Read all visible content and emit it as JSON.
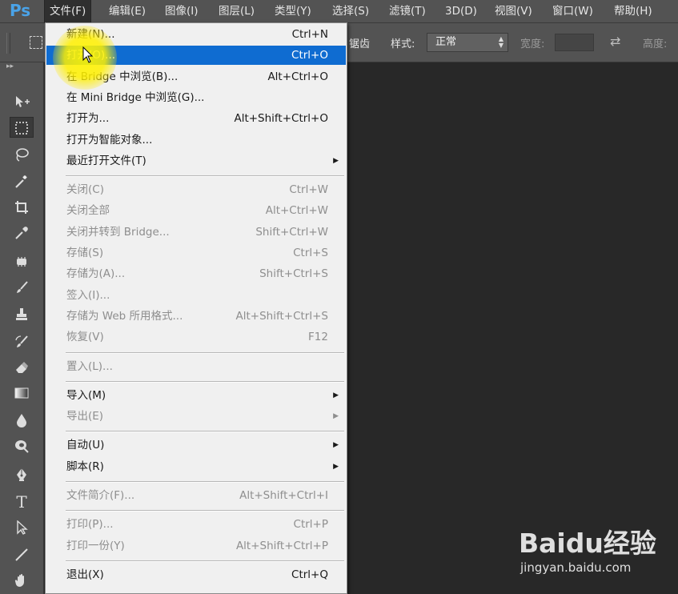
{
  "app": {
    "logo": "Ps"
  },
  "menubar": [
    {
      "label": "文件(F)",
      "active": true
    },
    {
      "label": "编辑(E)"
    },
    {
      "label": "图像(I)"
    },
    {
      "label": "图层(L)"
    },
    {
      "label": "类型(Y)"
    },
    {
      "label": "选择(S)"
    },
    {
      "label": "滤镜(T)"
    },
    {
      "label": "3D(D)"
    },
    {
      "label": "视图(V)"
    },
    {
      "label": "窗口(W)"
    },
    {
      "label": "帮助(H)"
    }
  ],
  "options": {
    "partial_label": "锯齿",
    "style_label": "样式:",
    "style_value": "正常",
    "width_label": "宽度:",
    "width_value": "",
    "height_label": "高度:"
  },
  "file_menu": [
    {
      "label": "新建(N)...",
      "shortcut": "Ctrl+N"
    },
    {
      "label": "打开(O)...",
      "shortcut": "Ctrl+O",
      "highlighted": true
    },
    {
      "label": "在 Bridge 中浏览(B)...",
      "shortcut": "Alt+Ctrl+O"
    },
    {
      "label": "在 Mini Bridge 中浏览(G)...",
      "shortcut": ""
    },
    {
      "label": "打开为...",
      "shortcut": "Alt+Shift+Ctrl+O"
    },
    {
      "label": "打开为智能对象...",
      "shortcut": ""
    },
    {
      "label": "最近打开文件(T)",
      "shortcut": "",
      "submenu": true
    },
    {
      "separator": true
    },
    {
      "label": "关闭(C)",
      "shortcut": "Ctrl+W",
      "disabled": true
    },
    {
      "label": "关闭全部",
      "shortcut": "Alt+Ctrl+W",
      "disabled": true
    },
    {
      "label": "关闭并转到 Bridge...",
      "shortcut": "Shift+Ctrl+W",
      "disabled": true
    },
    {
      "label": "存储(S)",
      "shortcut": "Ctrl+S",
      "disabled": true
    },
    {
      "label": "存储为(A)...",
      "shortcut": "Shift+Ctrl+S",
      "disabled": true
    },
    {
      "label": "签入(I)...",
      "shortcut": "",
      "disabled": true
    },
    {
      "label": "存储为 Web 所用格式...",
      "shortcut": "Alt+Shift+Ctrl+S",
      "disabled": true
    },
    {
      "label": "恢复(V)",
      "shortcut": "F12",
      "disabled": true
    },
    {
      "separator": true
    },
    {
      "label": "置入(L)...",
      "shortcut": "",
      "disabled": true
    },
    {
      "separator": true
    },
    {
      "label": "导入(M)",
      "shortcut": "",
      "submenu": true
    },
    {
      "label": "导出(E)",
      "shortcut": "",
      "submenu": true,
      "disabled": true
    },
    {
      "separator": true
    },
    {
      "label": "自动(U)",
      "shortcut": "",
      "submenu": true
    },
    {
      "label": "脚本(R)",
      "shortcut": "",
      "submenu": true
    },
    {
      "separator": true
    },
    {
      "label": "文件简介(F)...",
      "shortcut": "Alt+Shift+Ctrl+I",
      "disabled": true
    },
    {
      "separator": true
    },
    {
      "label": "打印(P)...",
      "shortcut": "Ctrl+P",
      "disabled": true
    },
    {
      "label": "打印一份(Y)",
      "shortcut": "Alt+Shift+Ctrl+P",
      "disabled": true
    },
    {
      "separator": true
    },
    {
      "label": "退出(X)",
      "shortcut": "Ctrl+Q"
    }
  ],
  "submenu_arrow": "▶",
  "tools": [
    {
      "name": "move-tool-icon"
    },
    {
      "name": "rectangular-marquee-tool-icon",
      "selected": true
    },
    {
      "name": "lasso-tool-icon"
    },
    {
      "name": "magic-wand-tool-icon"
    },
    {
      "name": "crop-tool-icon"
    },
    {
      "name": "eyedropper-tool-icon"
    },
    {
      "name": "spot-healing-brush-tool-icon"
    },
    {
      "name": "brush-tool-icon"
    },
    {
      "name": "clone-stamp-tool-icon"
    },
    {
      "name": "history-brush-tool-icon"
    },
    {
      "name": "eraser-tool-icon"
    },
    {
      "name": "gradient-tool-icon"
    },
    {
      "name": "blur-tool-icon"
    },
    {
      "name": "dodge-tool-icon"
    },
    {
      "name": "pen-tool-icon"
    },
    {
      "name": "type-tool-icon",
      "glyph": "T"
    },
    {
      "name": "path-selection-tool-icon"
    },
    {
      "name": "line-tool-icon"
    },
    {
      "name": "hand-tool-icon"
    }
  ],
  "watermark": {
    "brand": "Baidu经验",
    "url": "jingyan.baidu.com"
  },
  "colors": {
    "menu_highlight": "#0f6cd1",
    "ps_logo": "#4aa3e8",
    "cursor_halo": "#fff200"
  }
}
